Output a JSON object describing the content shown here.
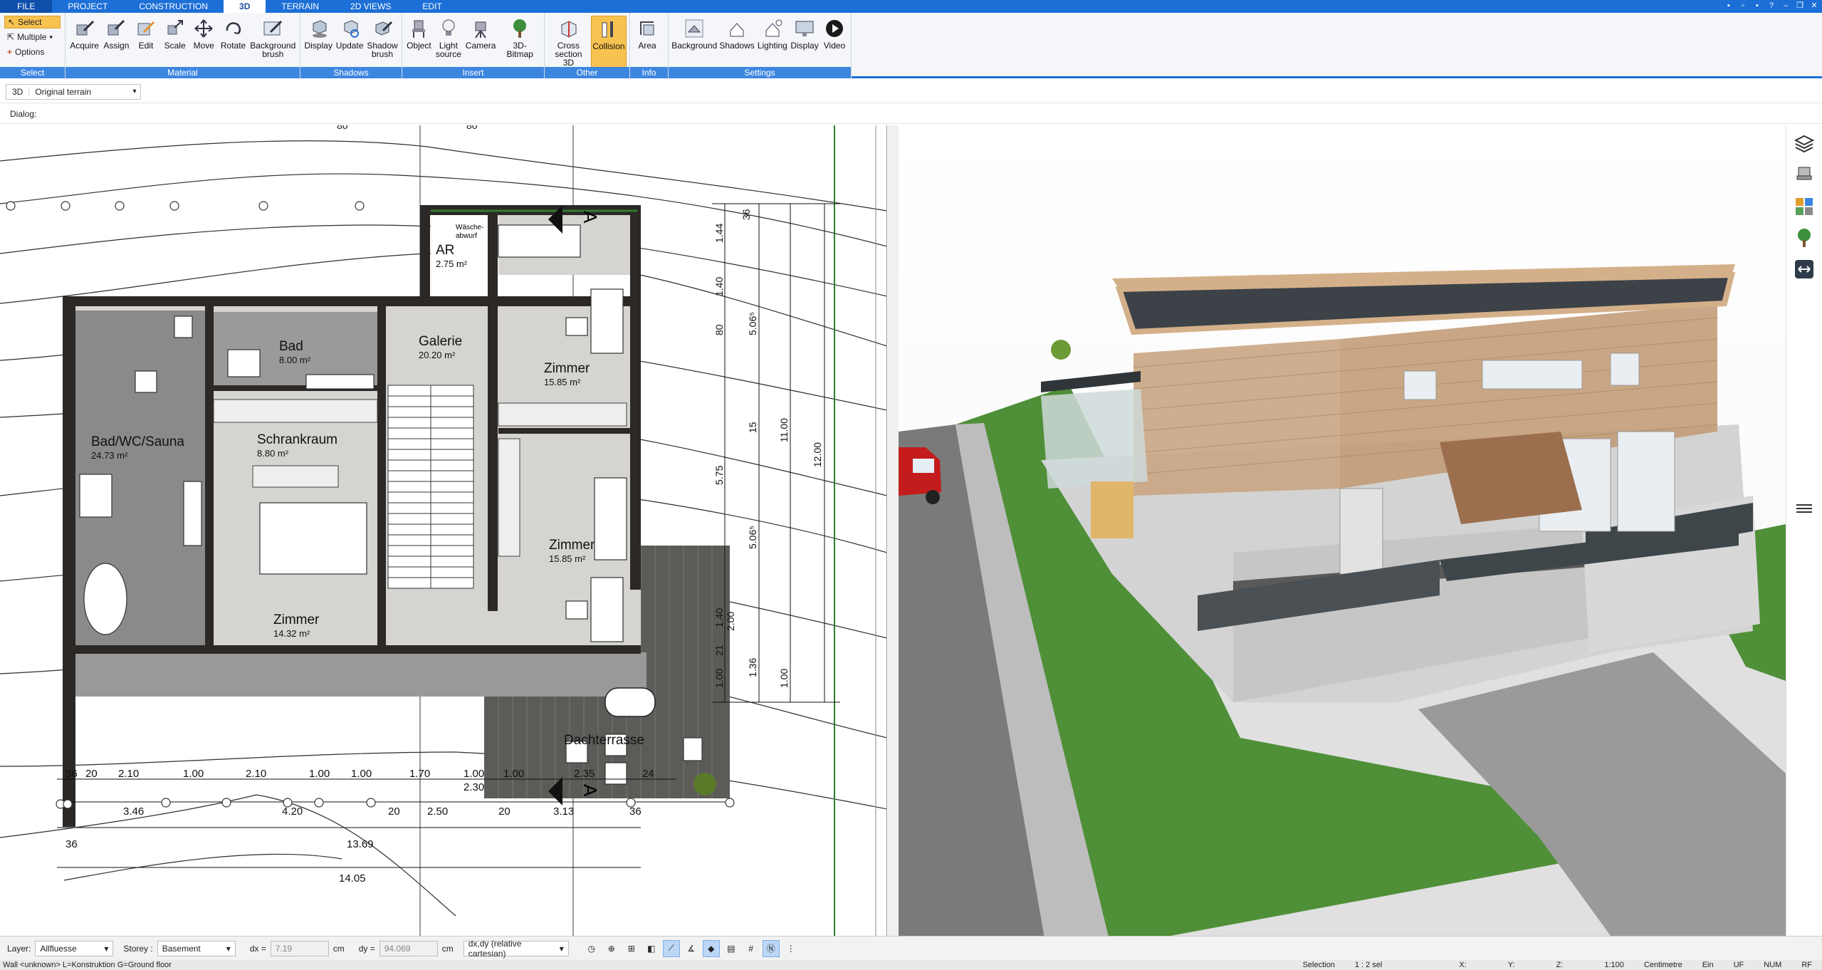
{
  "tabs": [
    "FILE",
    "PROJECT",
    "CONSTRUCTION",
    "3D",
    "TERRAIN",
    "2D VIEWS",
    "EDIT"
  ],
  "active_tab": "3D",
  "ribbon": {
    "select": {
      "name": "Select",
      "items": [
        "Select",
        "Multiple",
        "Options"
      ]
    },
    "material": {
      "name": "Material",
      "tools": [
        "Acquire",
        "Assign",
        "Edit",
        "Scale",
        "Move",
        "Rotate",
        "Background\nbrush"
      ]
    },
    "shadows": {
      "name": "Shadows",
      "tools": [
        "Display",
        "Update",
        "Shadow\nbrush"
      ]
    },
    "insert": {
      "name": "Insert",
      "tools": [
        "Object",
        "Light\nsource",
        "Camera",
        "3D-Bitmap"
      ]
    },
    "other": {
      "name": "Other",
      "tools": [
        "Cross\nsection 3D",
        "Collision"
      ]
    },
    "info": {
      "name": "Info",
      "tools": [
        "Area"
      ]
    },
    "settings": {
      "name": "Settings",
      "tools": [
        "Background",
        "Shadows",
        "Lighting",
        "Display",
        "Video"
      ]
    }
  },
  "context": {
    "view_prefix": "3D",
    "view_name": "Original terrain",
    "dialog_label": "Dialog:"
  },
  "plan": {
    "rooms": [
      {
        "name": "AR",
        "area": "2.75 m²"
      },
      {
        "name": "Bad",
        "area": "8.00 m²"
      },
      {
        "name": "Galerie",
        "area": "20.20 m²"
      },
      {
        "name": "Zimmer",
        "area": "15.85 m²"
      },
      {
        "name": "Bad/WC/Sauna",
        "area": "24.73 m²"
      },
      {
        "name": "Schrankraum",
        "area": "8.80 m²"
      },
      {
        "name": "Zimmer",
        "area": "15.85 m²"
      },
      {
        "name": "Zimmer",
        "area": "14.32 m²"
      },
      {
        "name": "Dachterrasse",
        "area": ""
      }
    ],
    "small_label": "Wäsche-\nabwurf",
    "top_dims": [
      "80",
      "80"
    ],
    "right_dims": [
      "36",
      "1.44",
      "1.40",
      "80",
      "5.06⁵",
      "15",
      "11.00",
      "12.00",
      "5.75",
      "5.06⁵",
      "1.40",
      "2.00",
      "21",
      "1.00",
      "1.36",
      "1.00"
    ],
    "bottom_row1": [
      "36",
      "20",
      "2.10",
      "1.00",
      "2.10",
      "1.00",
      "1.00",
      "1.70",
      "1.00",
      "1.00",
      "2.35",
      "24"
    ],
    "bottom_row1_sub": "2.30",
    "bottom_row2": [
      "3.46",
      "4.20",
      "20",
      "2.50",
      "20",
      "3.13",
      "36"
    ],
    "bottom_row3": [
      "36",
      "13.69"
    ],
    "bottom_row4": [
      "14.05"
    ],
    "section_marks": [
      "A",
      "A"
    ]
  },
  "bottombar": {
    "layer_label": "Layer:",
    "layer_value": "Allfluesse",
    "storey_label": "Storey :",
    "storey_value": "Basement",
    "dx_label": "dx =",
    "dx_value": "7.19",
    "dx_unit": "cm",
    "dy_label": "dy =",
    "dy_value": "94.069",
    "dy_unit": "cm",
    "coord_mode": "dx,dy (relative cartesian)"
  },
  "status": {
    "left": "Wall <unknown> L=Konstruktion G=Ground floor",
    "selection": "Selection",
    "selection_value": "1 : 2 sel",
    "x": "X:",
    "y": "Y:",
    "z": "Z:",
    "scale": "1:100",
    "unit": "Centimetre",
    "ein": "Ein",
    "uf": "UF",
    "num": "NUM",
    "rf": "RF"
  },
  "colors": {
    "accent": "#1c6fd6",
    "active": "#f7c250",
    "grass": "#4a8a35",
    "wood": "#c8a27d",
    "roof": "#3c4247"
  }
}
